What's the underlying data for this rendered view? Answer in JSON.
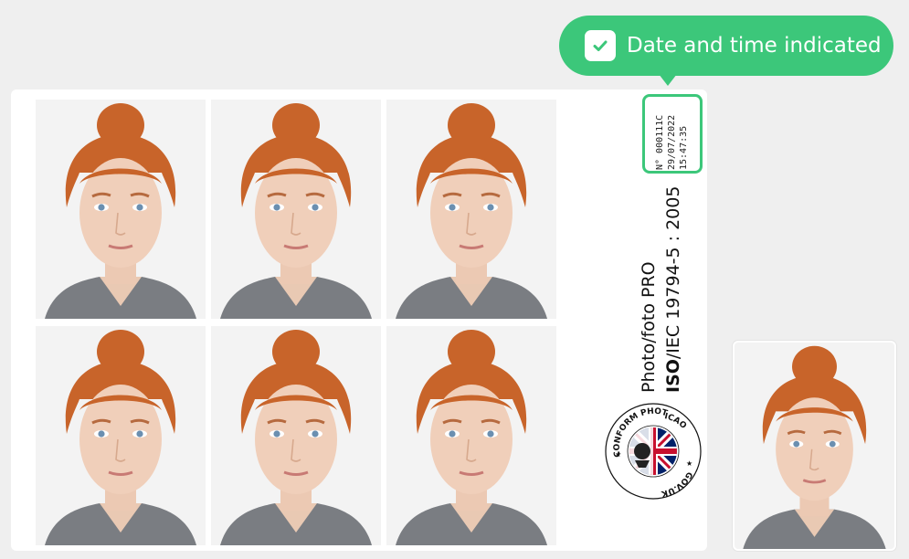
{
  "tooltip": {
    "text": "Date and time indicated",
    "icon": "check-icon",
    "color": "#3cc77a"
  },
  "stamp": {
    "number": "N° 000111C",
    "date": "29/07/2022",
    "time": "15:47:35"
  },
  "labels": {
    "product": "Photo/foto PRO",
    "iso_bold": "ISO",
    "iso_rest": "/IEC 19794-5 : 2005"
  },
  "seal": {
    "top_text": "CONFORM PHOTOS",
    "right_text": "ICAO",
    "bottom_text": "GOV.UK",
    "icon": "uk-flag-seal-icon"
  },
  "colors": {
    "background": "#efefef",
    "sheet": "#ffffff",
    "accent": "#3cc77a",
    "hair": "#c8642a"
  }
}
